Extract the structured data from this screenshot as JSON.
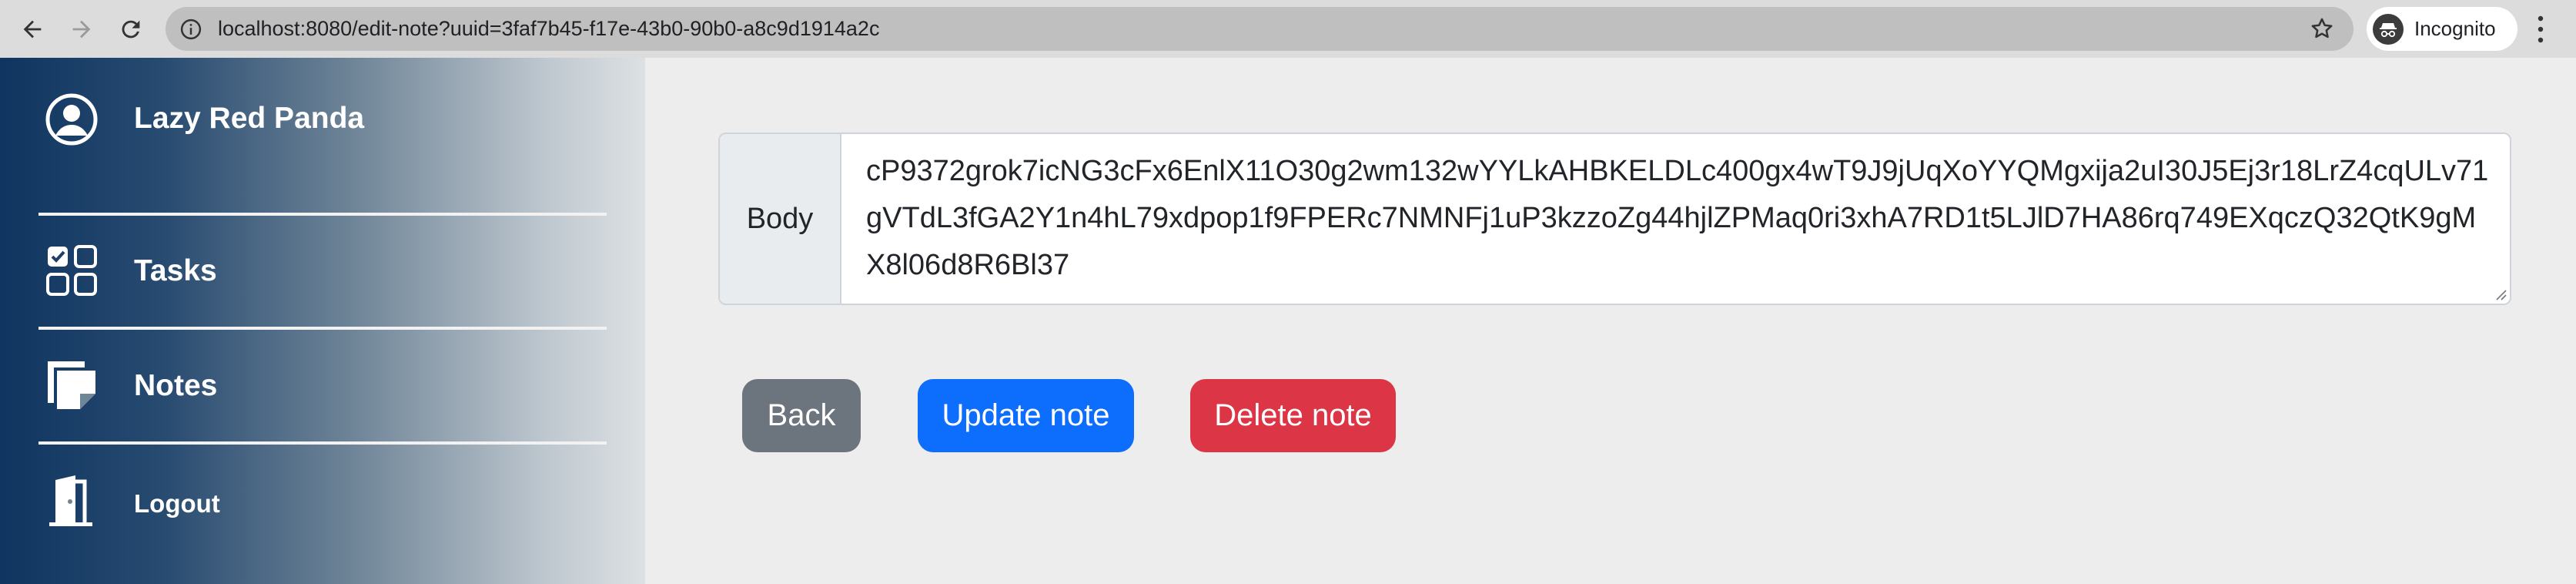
{
  "browser": {
    "url": "localhost:8080/edit-note?uuid=3faf7b45-f17e-43b0-90b0-a8c9d1914a2c",
    "incognito_label": "Incognito",
    "icons": [
      "back-arrow-icon",
      "forward-arrow-icon",
      "reload-icon",
      "info-icon",
      "star-icon",
      "incognito-icon",
      "kebab-menu-icon"
    ]
  },
  "sidebar": {
    "items": [
      {
        "label": "Lazy Red Panda",
        "icon": "user-circle-icon"
      },
      {
        "label": "Tasks",
        "icon": "tasks-grid-icon"
      },
      {
        "label": "Notes",
        "icon": "notes-icon"
      },
      {
        "label": "Logout",
        "icon": "door-exit-icon"
      }
    ],
    "gradient": [
      "#0f3560",
      "#dde1e4"
    ]
  },
  "form": {
    "body_label": "Body",
    "body_value": "cP9372grok7icNG3cFx6EnlX11O30g2wm132wYYLkAHBKELDLc400gx4wT9J9jUqXoYYQMgxija2uI30J5Ej3r18LrZ4cqULv71gVTdL3fGA2Y1n4hL79xdpop1f9FPERc7NMNFj1uP3kzzoZg44hjlZPMaq0ri3xhA7RD1t5LJlD7HA86rq749EXqczQ32QtK9gMX8l06d8R6Bl37"
  },
  "buttons": {
    "back": "Back",
    "update": "Update note",
    "delete": "Delete note"
  },
  "colors": {
    "back": "#6c757d",
    "update": "#0d6efd",
    "delete": "#dc3545"
  }
}
